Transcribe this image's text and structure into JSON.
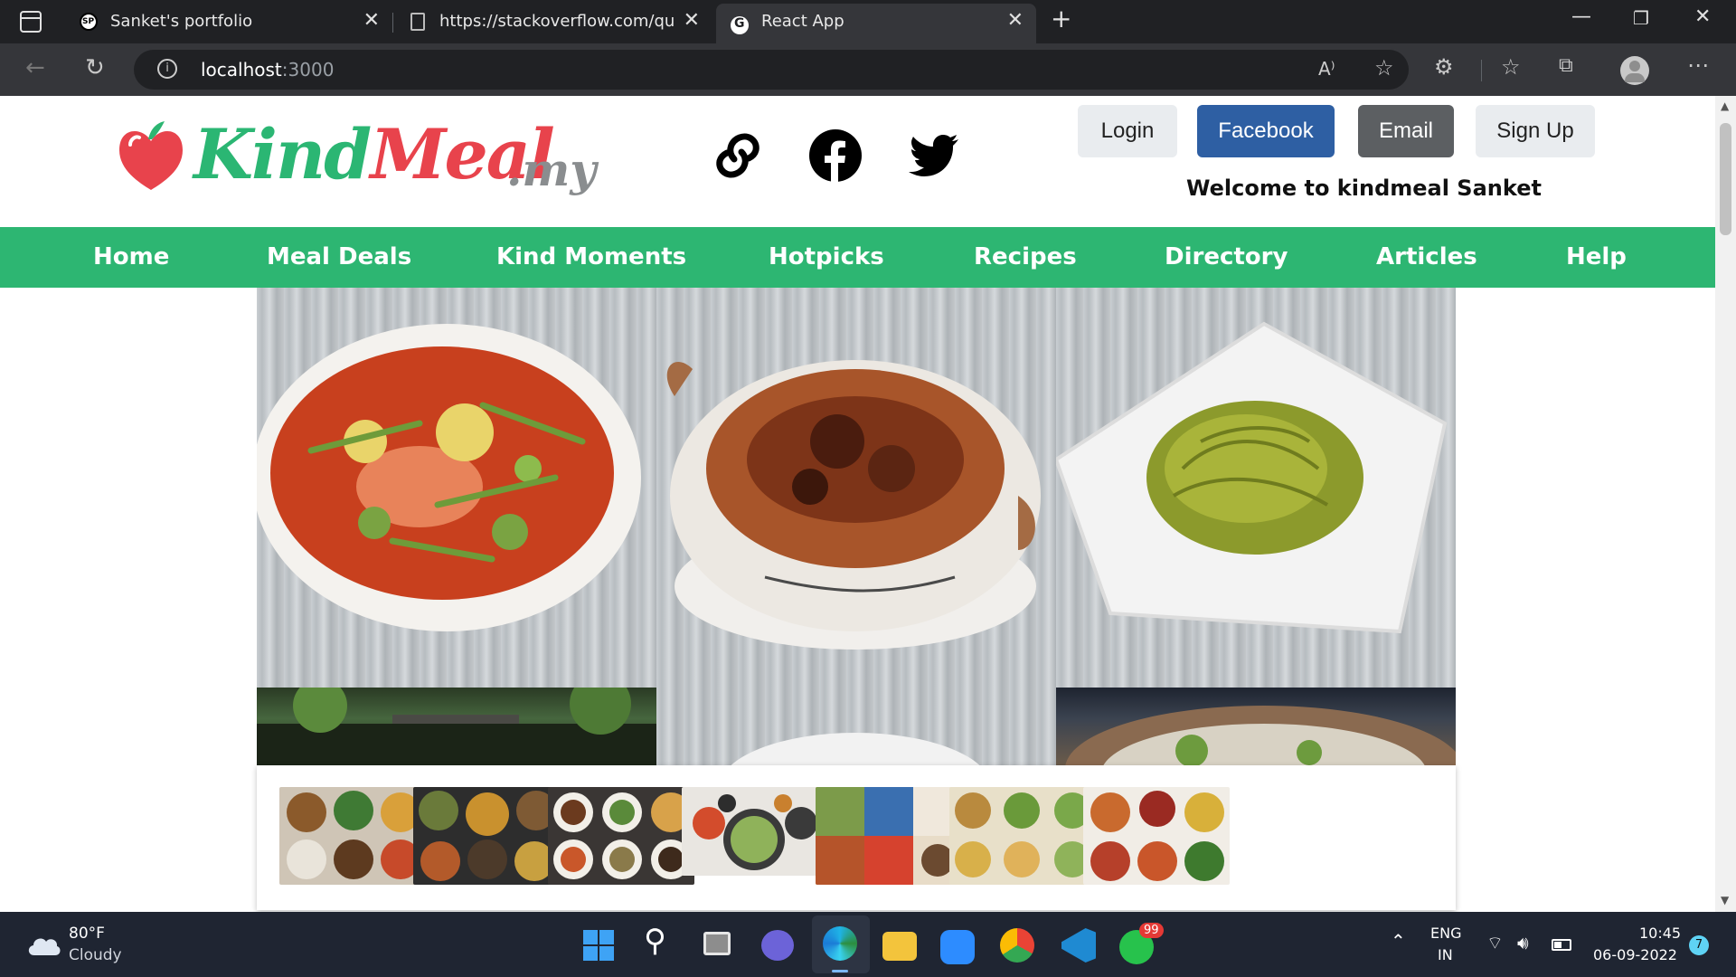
{
  "browser": {
    "tabs": [
      {
        "title": "Sanket's portfolio",
        "favicon": "sp-logo-icon"
      },
      {
        "title": "https://stackoverflow.com/questi",
        "favicon": "page-icon"
      },
      {
        "title": "React App",
        "favicon": "react-app-icon"
      }
    ],
    "url_host": "localhost",
    "url_port": ":3000"
  },
  "header": {
    "logo": {
      "kind": "Kind",
      "meal": "Meal",
      "tld": ".my"
    },
    "buttons": {
      "login": "Login",
      "facebook": "Facebook",
      "email": "Email",
      "signup": "Sign Up"
    },
    "welcome": "Welcome to kindmeal Sanket"
  },
  "nav": [
    "Home",
    "Meal Deals",
    "Kind Moments",
    "Hotpicks",
    "Recipes",
    "Directory",
    "Articles",
    "Help"
  ],
  "taskbar": {
    "temp": "80°F",
    "weather": "Cloudy",
    "lang1": "ENG",
    "lang2": "IN",
    "time": "10:45",
    "date": "06-09-2022",
    "whatsapp_badge": "99",
    "notif_count": "7"
  },
  "colors": {
    "brand_green": "#2db672",
    "brand_red": "#e8434c",
    "facebook_blue": "#2e5fa3",
    "email_gray": "#5c5f62"
  }
}
